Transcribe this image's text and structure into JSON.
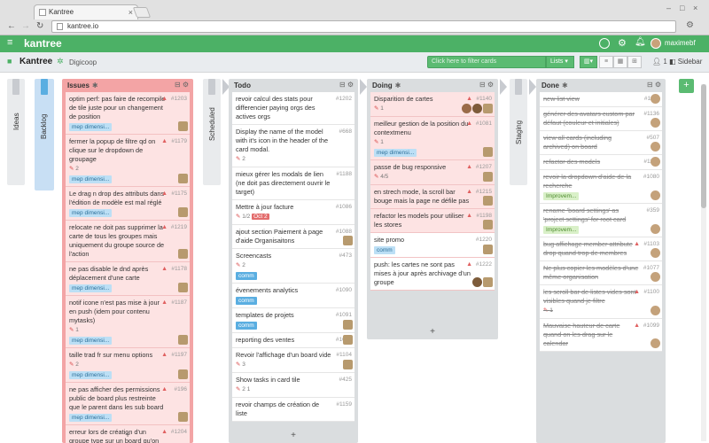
{
  "browser": {
    "tab_title": "Kantree",
    "url": "kantree.io"
  },
  "app": {
    "logo": "kantree",
    "user": "maximebf"
  },
  "board": {
    "title": "Kantree",
    "org": "Digicoop",
    "filter_placeholder": "Click here to filter cards",
    "lists_label": "Lists",
    "member_count": "1",
    "sidebar_label": "Sidebar"
  },
  "collapsed": {
    "ideas": "Ideas",
    "backlog": "Backlog",
    "scheduled": "Scheduled",
    "staging": "Staging"
  },
  "columns": {
    "issues": {
      "title": "Issues",
      "cards": [
        {
          "text": "optim perf: pas faire de recompile de tile juste pour un changement de position",
          "num": "#1203",
          "tag": "mep dimensi..."
        },
        {
          "text": "fermer la popup de filtre qd on clique sur le dropdown de groupage",
          "num": "#1179",
          "meta": "2",
          "tag": "mep dimensi..."
        },
        {
          "text": "Le drag n drop des attributs dans l'édition de modèle est mal réglé",
          "num": "#1175",
          "tag": "mep dimensi..."
        },
        {
          "text": "relocate ne doit pas supprimer la carte de tous les groupes mais uniquement du groupe source de l'action",
          "num": "#1219"
        },
        {
          "text": "ne pas disable le dnd après déplacement d'une carte",
          "num": "#1178",
          "tag": "mep dimensi..."
        },
        {
          "text": "notif icone n'est pas mise à jour en push (idem pour contenu mytasks)",
          "num": "#1187",
          "meta": "1",
          "tag": "mep dimensi..."
        },
        {
          "text": "taille trad fr sur menu options",
          "num": "#1197",
          "meta": "2",
          "tag": "mep dimensi..."
        },
        {
          "text": "ne pas afficher des permissions public de board plus restreinte que le parent dans les sub board",
          "num": "#196",
          "tag": "mep dimensi..."
        },
        {
          "text": "erreur lors de création d'un groupe type sur un board qu'on n'a",
          "num": "#1204"
        }
      ]
    },
    "todo": {
      "title": "Todo",
      "cards": [
        {
          "text": "revoir calcul des stats pour differencier paying orgs des actives orgs",
          "num": "#1202"
        },
        {
          "text": "Display the name of the model with it's icon in the header of the card modal.",
          "num": "#668",
          "meta": "2"
        },
        {
          "text": "mieux gérer les modals de lien (ne doit pas directement ouvrir le target)",
          "num": "#1188"
        },
        {
          "text": "Mettre à jour facture",
          "num": "#1086",
          "meta": "1/2",
          "date": "Oct 2"
        },
        {
          "text": "ajout section Paiement à page d'aide Organisaitons",
          "num": "#1088"
        },
        {
          "text": "Screencasts",
          "num": "#473",
          "meta": "2",
          "tag": "comm"
        },
        {
          "text": "évenements analytics",
          "num": "#1090",
          "tag": "comm"
        },
        {
          "text": "templates de projets",
          "num": "#1091",
          "tag": "comm"
        },
        {
          "text": "reporting des ventes",
          "num": "#1092"
        },
        {
          "text": "Revoir l'affichage d'un board vide",
          "num": "#1104",
          "meta": "3"
        },
        {
          "text": "Show tasks in card tile",
          "num": "#425",
          "meta": "2",
          "meta2": "1"
        },
        {
          "text": "revoir champs de création de liste",
          "num": "#1159"
        }
      ]
    },
    "doing": {
      "title": "Doing",
      "cards": [
        {
          "text": "Disparition de cartes",
          "num": "#1140",
          "meta": "1"
        },
        {
          "text": "meilleur gestion de la position du contextmenu",
          "num": "#1081",
          "meta": "1",
          "tag": "mep dimensi..."
        },
        {
          "text": "passe de bug responsive",
          "num": "#1207",
          "meta": "4/5"
        },
        {
          "text": "en strech mode, la scroll bar bouge mais la page ne défile pas",
          "num": "#1215"
        },
        {
          "text": "refactor les models pour utiliser les stores",
          "num": "#1198"
        },
        {
          "text": "site promo",
          "num": "#1220",
          "tag": "comm"
        },
        {
          "text": "push: les cartes ne sont pas mises à jour après archivage d'un groupe",
          "num": "#1222"
        }
      ]
    },
    "done": {
      "title": "Done",
      "cards": [
        {
          "text": "new list view",
          "num": "#1117"
        },
        {
          "text": "générer des avatars custom par défaut (couleur et initiales)",
          "num": "#1136"
        },
        {
          "text": "view all cards (including archived) on board",
          "num": "#507"
        },
        {
          "text": "refactor des models",
          "num": "#1127"
        },
        {
          "text": "revoir la dropdown d'aide de la recherche",
          "num": "#1080",
          "tag": "Improvem..."
        },
        {
          "text": "rename 'board settings' as 'project settings' for root card",
          "num": "#359",
          "tag": "Improvem..."
        },
        {
          "text": "bug affichage member attribute drop quand trop de membres",
          "num": "#1103"
        },
        {
          "text": "Ne plus copier les modèles d'une même organisation",
          "num": "#1077"
        },
        {
          "text": "les scroll bar de listes vides sont visibles quand je filtre",
          "num": "#1100",
          "meta": "1"
        },
        {
          "text": "Mauvaise hauteur de carte quand on les drag sur le calendar",
          "num": "#1099"
        }
      ]
    }
  }
}
